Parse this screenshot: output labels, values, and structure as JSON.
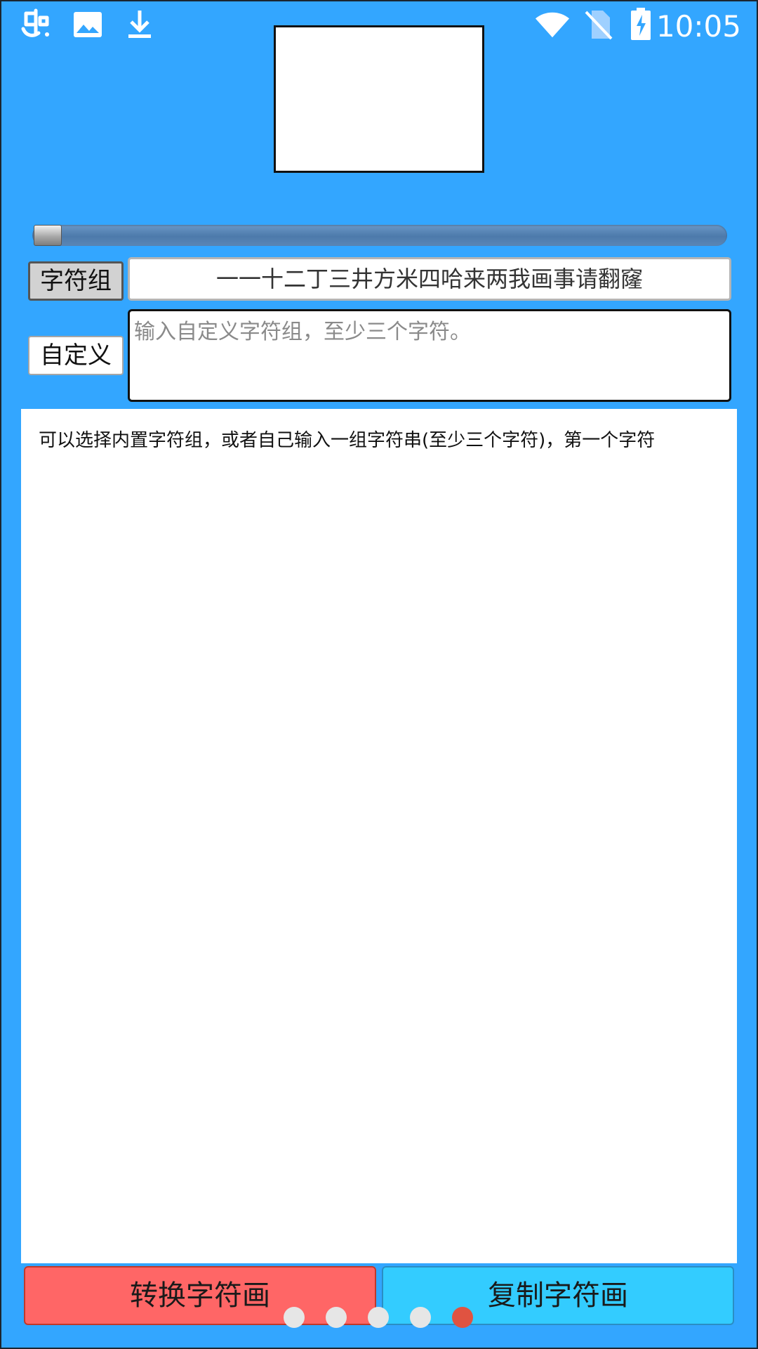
{
  "status_bar": {
    "time": "10:05",
    "icons": [
      "app-logo-icon",
      "image-icon",
      "download-icon",
      "wifi-icon",
      "no-sim-icon",
      "battery-charging-icon"
    ]
  },
  "charset": {
    "button_label": "字符组",
    "selected_value": "一一十二丁三井方米四哈来两我画事请翻窿"
  },
  "custom": {
    "button_label": "自定义",
    "placeholder": "输入自定义字符组，至少三个字符。",
    "value": ""
  },
  "slider": {
    "value_fraction": 0.0
  },
  "output": {
    "text": "可以选择内置字符组，或者自己输入一组字符串(至少三个字符)，第一个字符"
  },
  "actions": {
    "convert_label": "转换字符画",
    "copy_label": "复制字符画"
  },
  "pager": {
    "count": 5,
    "active_index": 4
  },
  "colors": {
    "background": "#33a6ff",
    "convert_button": "#ff6666",
    "copy_button": "#33ccff",
    "active_dot": "#e05341",
    "inactive_dot": "#e6e6e6"
  }
}
